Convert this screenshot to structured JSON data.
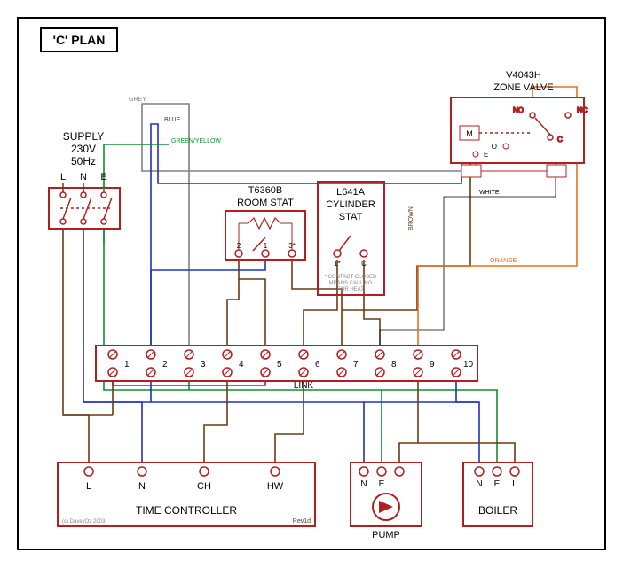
{
  "title": "'C' PLAN",
  "supply": {
    "header": "SUPPLY",
    "voltage": "230V",
    "freq": "50Hz",
    "L": "L",
    "N": "N",
    "E": "E"
  },
  "roomstat": {
    "model": "T6360B",
    "name": "ROOM STAT",
    "t1": "1",
    "t2": "2",
    "t3": "3*"
  },
  "cylstat": {
    "model": "L641A",
    "name1": "CYLINDER",
    "name2": "STAT",
    "t1": "1*",
    "tc": "C",
    "note1": "* CONTACT CLOSED",
    "note2": "MEANS CALLING",
    "note3": "FOR HEAT"
  },
  "zonevalve": {
    "model": "V4043H",
    "name": "ZONE VALVE",
    "m": "M",
    "no": "NO",
    "nc": "NC",
    "o": "O",
    "e": "E",
    "c": "C"
  },
  "junction": {
    "t1": "1",
    "t2": "2",
    "t3": "3",
    "t4": "4",
    "t5": "5",
    "t6": "6",
    "t7": "7",
    "t8": "8",
    "t9": "9",
    "t10": "10",
    "link": "LINK"
  },
  "timecontroller": {
    "name": "TIME CONTROLLER",
    "L": "L",
    "N": "N",
    "CH": "CH",
    "HW": "HW",
    "copy": "(c) DaveyOz 2003",
    "rev": "Rev1d"
  },
  "pump": {
    "name": "PUMP",
    "N": "N",
    "E": "E",
    "L": "L"
  },
  "boiler": {
    "name": "BOILER",
    "N": "N",
    "E": "E",
    "L": "L"
  },
  "wires": {
    "grey": "GREY",
    "blue": "BLUE",
    "greenyellow": "GREEN/YELLOW",
    "brown": "BROWN",
    "white": "WHITE",
    "orange": "ORANGE"
  },
  "colors": {
    "dkred": "#b02020",
    "red": "#d02020",
    "blue": "#2030c0",
    "green": "#109030",
    "brown": "#6b3b12",
    "orange": "#e87020",
    "grey": "#808080",
    "black": "#000000",
    "white": "#ffffff"
  }
}
